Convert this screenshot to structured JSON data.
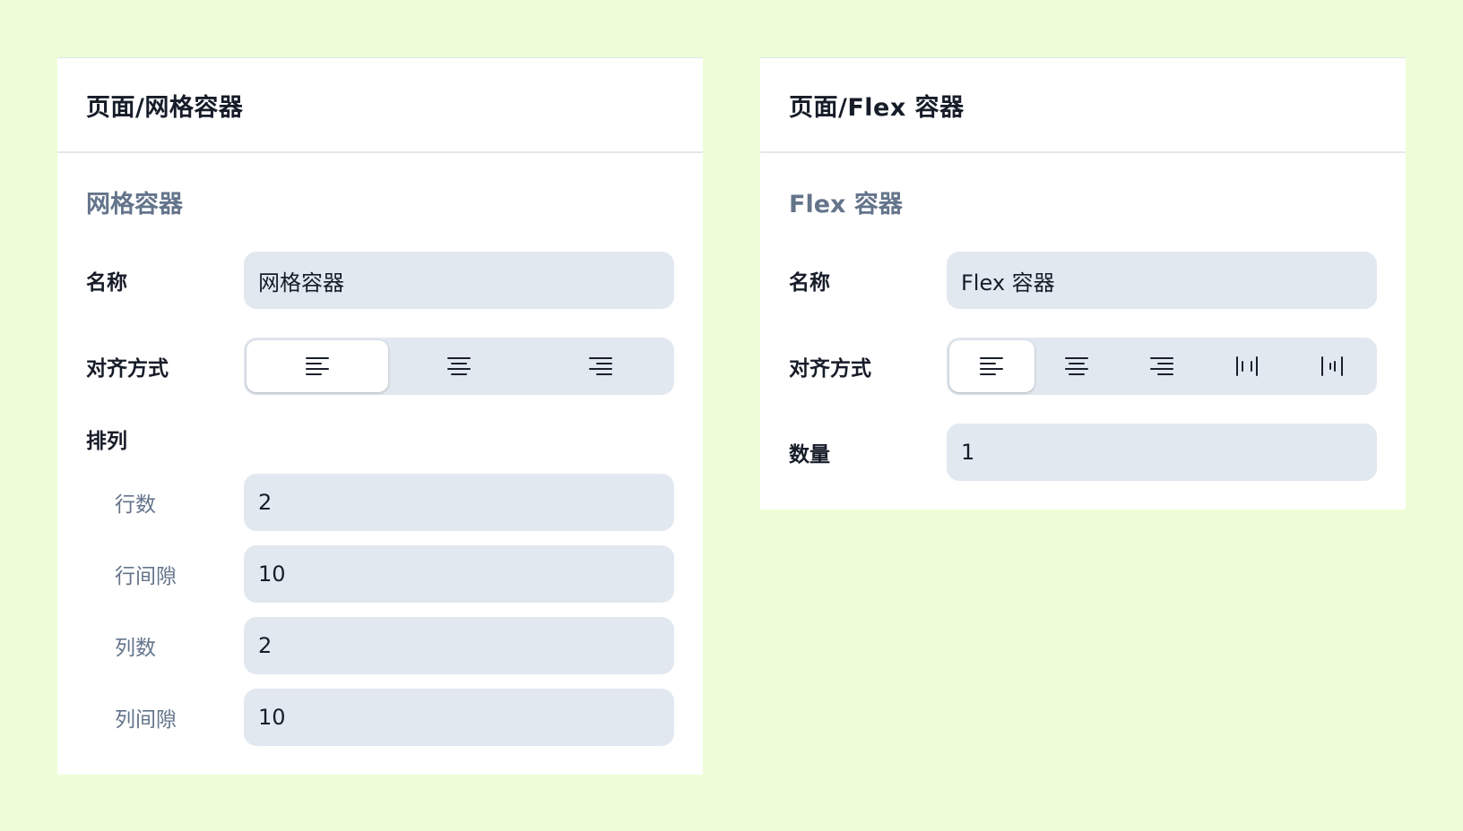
{
  "panels": {
    "grid": {
      "title": "页面/网格容器",
      "section_title": "网格容器",
      "name_label": "名称",
      "name_value": "网格容器",
      "align_label": "对齐方式",
      "align_options": [
        "align-left-icon",
        "align-center-icon",
        "align-right-icon"
      ],
      "align_selected": "align-left-icon",
      "arrange_label": "排列",
      "rows_label": "行数",
      "rows_value": "2",
      "row_gap_label": "行间隙",
      "row_gap_value": "10",
      "cols_label": "列数",
      "cols_value": "2",
      "col_gap_label": "列间隙",
      "col_gap_value": "10"
    },
    "flex": {
      "title": "页面/Flex 容器",
      "section_title": "Flex 容器",
      "name_label": "名称",
      "name_value": "Flex 容器",
      "align_label": "对齐方式",
      "align_options": [
        "align-left-icon",
        "align-center-icon",
        "align-right-icon",
        "space-between-icon",
        "space-around-icon"
      ],
      "align_selected": "align-left-icon",
      "count_label": "数量",
      "count_value": "1"
    }
  },
  "colors": {
    "background": "#eefdd7",
    "panel": "#ffffff",
    "field": "#e2e8f0",
    "muted_text": "#64748b",
    "text": "#161c28"
  }
}
